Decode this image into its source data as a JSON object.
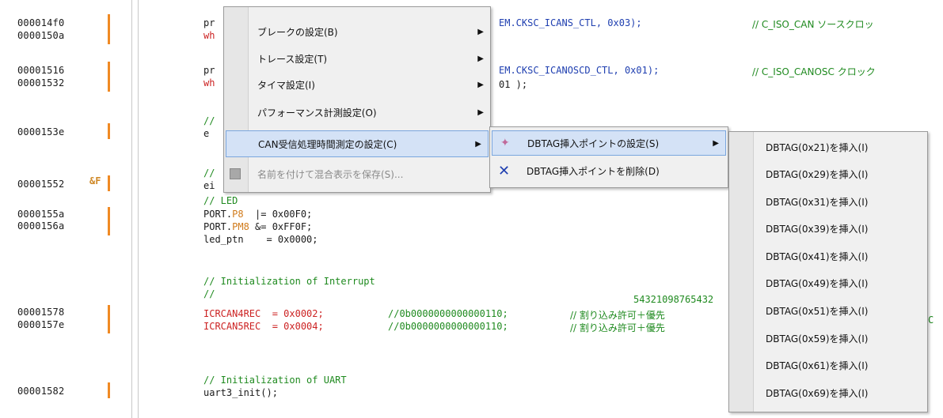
{
  "addresses": [
    "000014f0",
    "0000150a",
    "00001516",
    "00001532",
    "0000153e",
    "00001552",
    "0000155a",
    "0000156a",
    "00001578",
    "0000157e",
    "00001582"
  ],
  "breakpoint_glyph": "&F",
  "code": {
    "l1a": "pr",
    "l1b": "wh",
    "l1_tail": "EM.CKSC_ICANS_CTL, 0x03);",
    "l1_comment": "// C_ISO_CAN ソースクロッ",
    "l2a": "pr",
    "l2b": "wh",
    "l2_tail": "EM.CKSC_ICANOSCD_CTL, 0x01);",
    "l2_tail2": "01 );",
    "l2_comment": "// C_ISO_CANOSC クロック",
    "l3a": "//",
    "l3b": "e",
    "l4a": "//",
    "l4b": "ei",
    "led_comment": "// LED",
    "p8_a": "PORT.",
    "p8_b": "P8",
    "p8_c": "  |= 0x00F0;",
    "pm8_a": "PORT.",
    "pm8_b": "PM8",
    "pm8_c": " &= 0xFF0F;",
    "led_ptn": "led_ptn    = 0x0000;",
    "init_int": "// Initialization of Interrupt",
    "slashes": "//",
    "digits": "54321098765432",
    "icr4": "ICRCAN4REC  = 0x0002;",
    "icr4_c": "//0b0000000000000110;",
    "icr4_j": "// 割り込み許可＋優先",
    "icr5": "ICRCAN5REC  = 0x0004;",
    "icr5_c": "//0b0000000000000110;",
    "icr5_j": "// 割り込み許可＋優先",
    "trail": "C",
    "init_uart": "// Initialization of UART",
    "uart": "uart3_init();"
  },
  "menu1": {
    "items": [
      {
        "label": "ブレークの設定(B)",
        "submenu": true
      },
      {
        "label": "トレース設定(T)",
        "submenu": true
      },
      {
        "label": "タイマ設定(I)",
        "submenu": true
      },
      {
        "label": "パフォーマンス計測設定(O)",
        "submenu": true
      },
      {
        "label": "CAN受信処理時間測定の設定(C)",
        "submenu": true,
        "highlighted": true
      },
      {
        "label": "名前を付けて混合表示を保存(S)...",
        "disabled": true,
        "icon": "save-icon"
      }
    ]
  },
  "menu2": {
    "items": [
      {
        "label": "DBTAG挿入ポイントの設定(S)",
        "submenu": true,
        "highlighted": true,
        "icon": "wand-icon"
      },
      {
        "label": "DBTAG挿入ポイントを削除(D)",
        "icon": "delete-x-icon"
      }
    ]
  },
  "menu3": {
    "items": [
      "DBTAG(0x21)を挿入(I)",
      "DBTAG(0x29)を挿入(I)",
      "DBTAG(0x31)を挿入(I)",
      "DBTAG(0x39)を挿入(I)",
      "DBTAG(0x41)を挿入(I)",
      "DBTAG(0x49)を挿入(I)",
      "DBTAG(0x51)を挿入(I)",
      "DBTAG(0x59)を挿入(I)",
      "DBTAG(0x61)を挿入(I)",
      "DBTAG(0x69)を挿入(I)"
    ]
  }
}
